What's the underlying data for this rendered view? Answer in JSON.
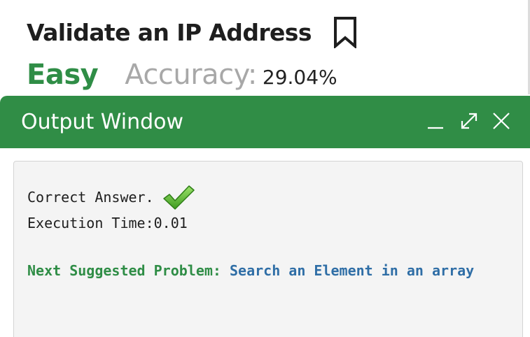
{
  "problem": {
    "title": "Validate an IP Address",
    "difficulty": "Easy",
    "accuracy_label": "Accuracy:",
    "accuracy_value": "29.04%"
  },
  "output_window": {
    "title": "Output Window",
    "result_text": "Correct Answer.",
    "execution_time": "Execution Time:0.01",
    "next_label": "Next Suggested Problem:",
    "next_problem": "Search an Element in an array"
  },
  "icons": {
    "bookmark": "bookmark-icon",
    "minimize": "minimize-icon",
    "maximize": "maximize-icon",
    "close": "close-icon",
    "check": "checkmark-icon"
  },
  "colors": {
    "accent_green": "#308d46",
    "easy_green": "#2f8d46",
    "link_blue": "#2f6ea6",
    "muted_gray": "#a8a8a8",
    "panel_bg": "#f4f4f4"
  }
}
